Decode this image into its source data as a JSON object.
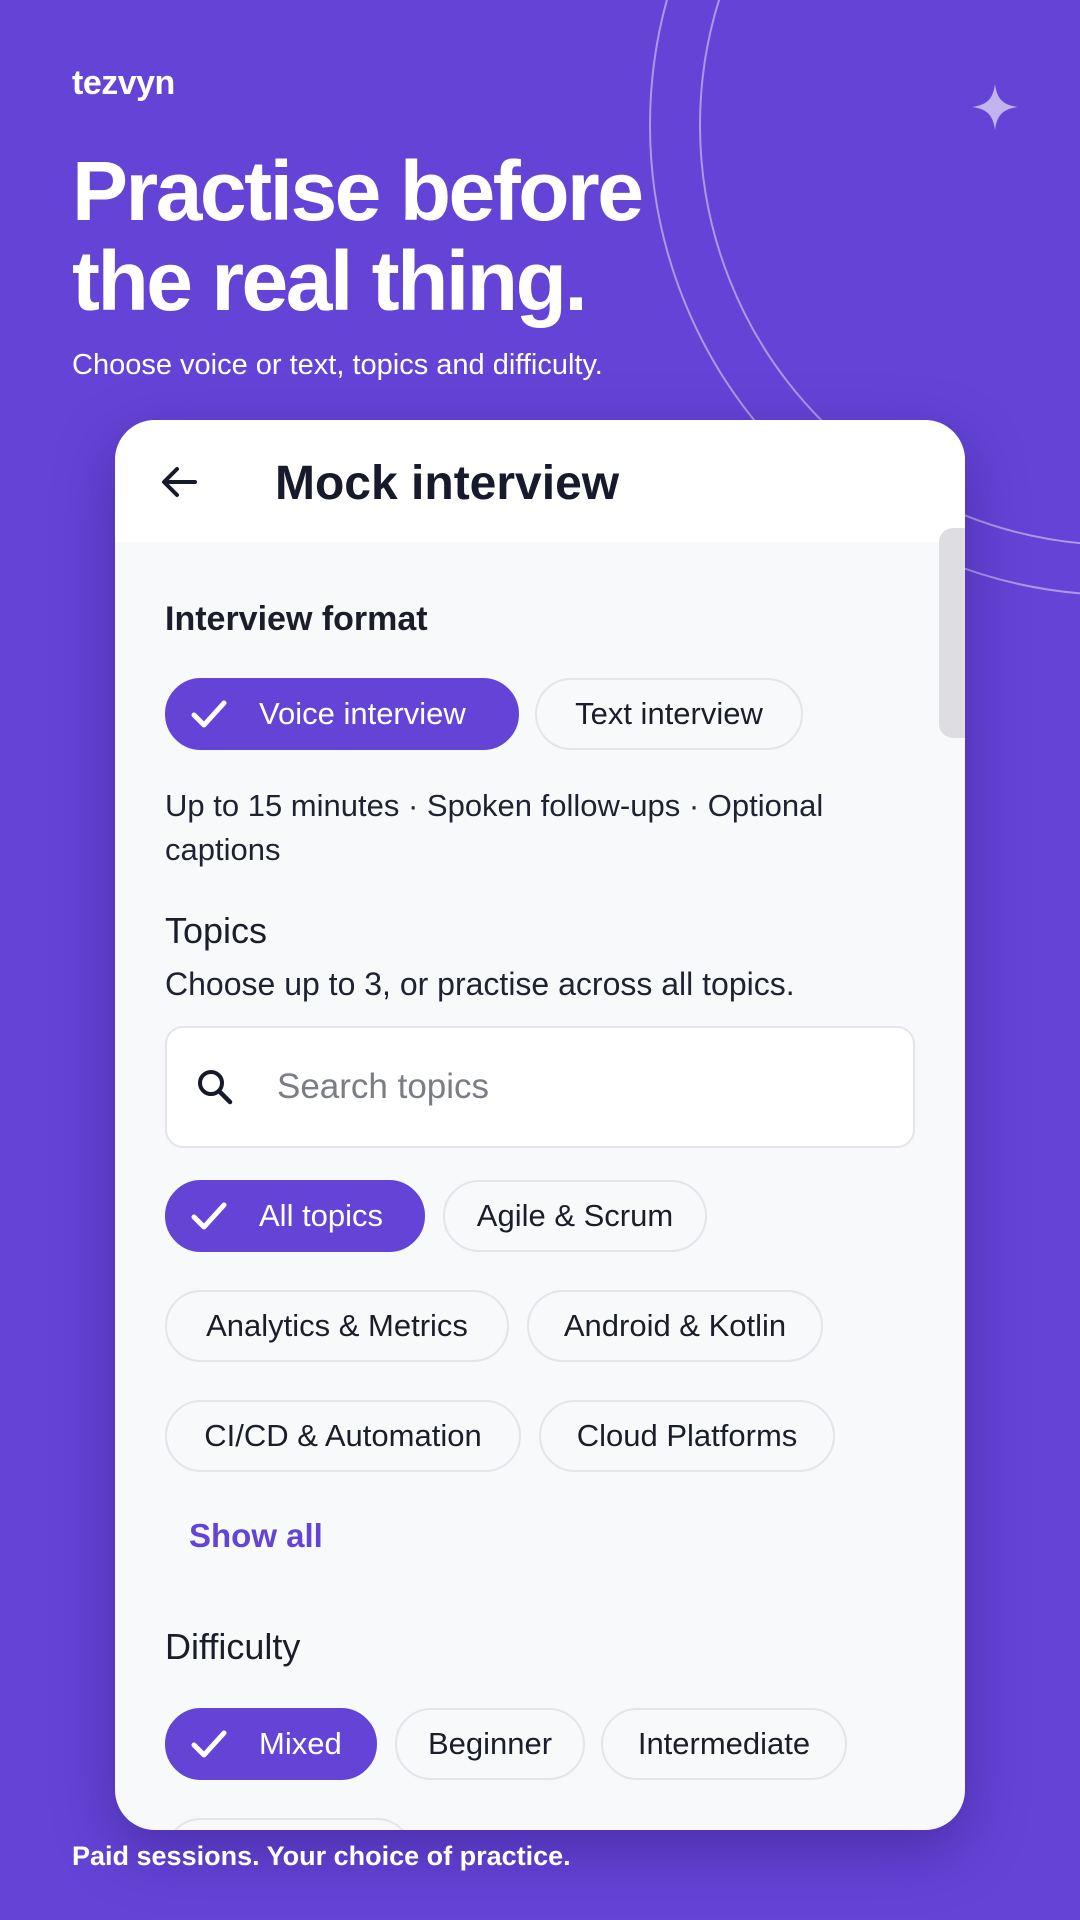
{
  "brand": "tezvyn",
  "hero": {
    "headline_line1": "Practise before",
    "headline_line2": "the real thing.",
    "subhead": "Choose voice or text, topics and difficulty."
  },
  "footer": "Paid sessions. Your choice of practice.",
  "colors": {
    "accent": "#6444d6",
    "surface": "#f8f9fb",
    "text": "#171a2b"
  },
  "app": {
    "title": "Mock interview",
    "format": {
      "label": "Interview format",
      "options": [
        {
          "label": "Voice interview",
          "selected": true
        },
        {
          "label": "Text interview",
          "selected": false
        }
      ],
      "description": "Up to 15 minutes · Spoken follow-ups · Optional captions"
    },
    "topics": {
      "label": "Topics",
      "hint": "Choose up to 3, or practise across all topics.",
      "search_placeholder": "Search topics",
      "chips": [
        {
          "label": "All topics",
          "selected": true
        },
        {
          "label": "Agile & Scrum",
          "selected": false
        },
        {
          "label": "Analytics & Metrics",
          "selected": false
        },
        {
          "label": "Android & Kotlin",
          "selected": false
        },
        {
          "label": "CI/CD & Automation",
          "selected": false
        },
        {
          "label": "Cloud Platforms",
          "selected": false
        }
      ],
      "show_all": "Show all"
    },
    "difficulty": {
      "label": "Difficulty",
      "chips": [
        {
          "label": "Mixed",
          "selected": true
        },
        {
          "label": "Beginner",
          "selected": false
        },
        {
          "label": "Intermediate",
          "selected": false
        }
      ]
    }
  }
}
